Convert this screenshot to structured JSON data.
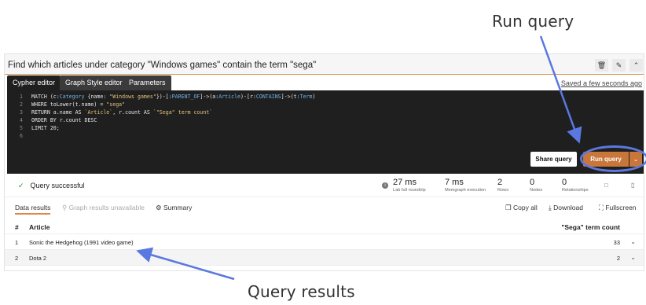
{
  "callouts": {
    "run_query": "Run query",
    "query_results": "Query results"
  },
  "query": {
    "title": "Find which articles under category \"Windows games\" contain the term \"sega\"",
    "saved_status": "Saved a few seconds ago"
  },
  "editor_tabs": [
    "Cypher editor",
    "Graph Style editor",
    "Parameters"
  ],
  "code": {
    "line_numbers": [
      "1",
      "2",
      "3",
      "4",
      "5",
      "6"
    ],
    "l1": {
      "a": "MATCH (c:",
      "b": "Category",
      "c": " {name: ",
      "d": "\"Windows games\"",
      "e": "})-[:",
      "f": "PARENT_OF",
      "g": "]->(a:",
      "h": "Article",
      "i": ")-[r:",
      "j": "CONTAINS",
      "k": "]->(t:",
      "l": "Term",
      "m": ")"
    },
    "l2": {
      "a": "WHERE toLower(t.name) = ",
      "b": "\"sega\""
    },
    "l3": {
      "a": "RETURN a.name AS ",
      "b": "`Article`",
      "c": ", r.count AS ",
      "d": "`\"Sega\" term count`"
    },
    "l4": "ORDER BY r.count DESC",
    "l5": "LIMIT 20;",
    "l6": ""
  },
  "buttons": {
    "share": "Share query",
    "run": "Run query",
    "run_dropdown_icon": "chevron-down-icon"
  },
  "status": {
    "message": "Query successful",
    "metrics": [
      {
        "value": "27 ms",
        "caption": "Lab full roundtrip"
      },
      {
        "value": "7 ms",
        "caption": "Memgraph execution"
      },
      {
        "value": "2",
        "caption": "Rows"
      },
      {
        "value": "0",
        "caption": "Nodes"
      },
      {
        "value": "0",
        "caption": "Relationships"
      }
    ]
  },
  "results_tabs": {
    "data": "Data results",
    "graph": "Graph results unavailable",
    "summary": "Summary",
    "copy_all": "Copy all",
    "download": "Download",
    "fullscreen": "Fullscreen"
  },
  "table": {
    "headers": [
      "#",
      "Article",
      "\"Sega\" term count"
    ],
    "rows": [
      {
        "index": "1",
        "article": "Sonic the Hedgehog (1991 video game)",
        "count": "33"
      },
      {
        "index": "2",
        "article": "Dota 2",
        "count": "2"
      }
    ]
  },
  "colors": {
    "accent": "#c8763a",
    "annotation": "#5a78e0",
    "editor_bg": "#1f1f1f",
    "success": "#2f8a3d"
  }
}
